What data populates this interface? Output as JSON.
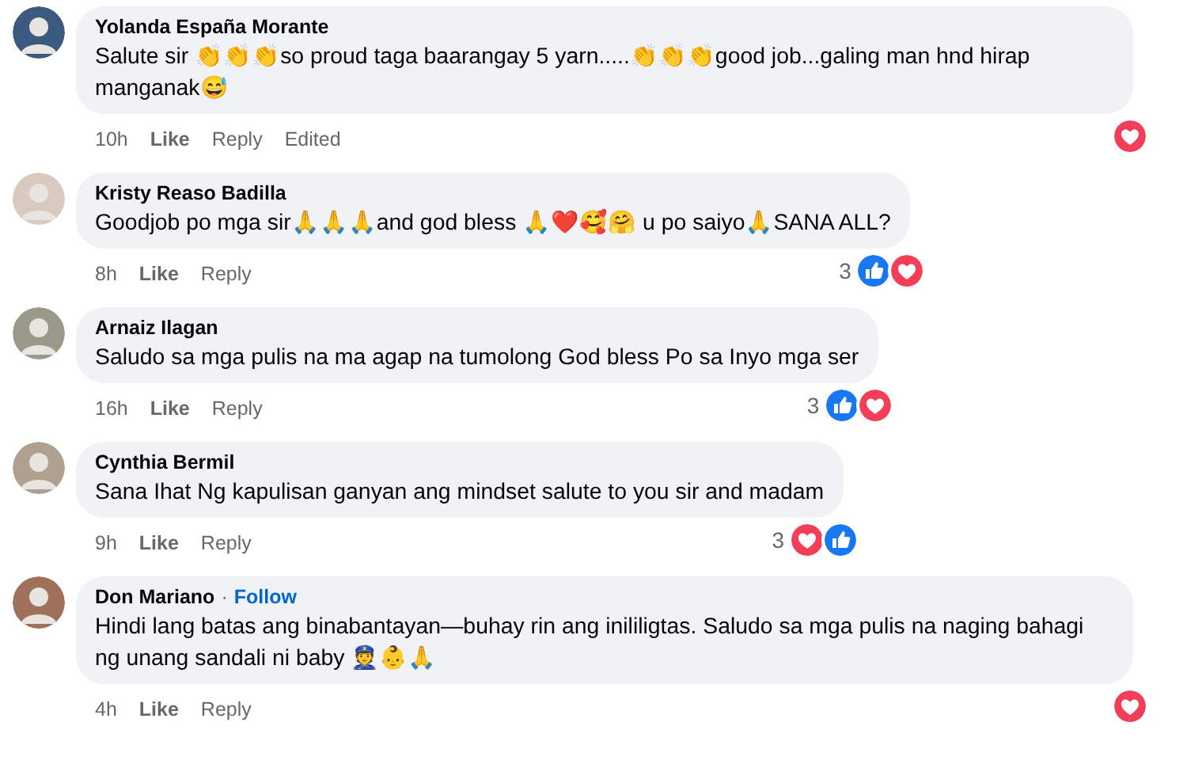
{
  "comments": [
    {
      "author": "Yolanda España Morante",
      "text": "Salute sir 👏👏👏so proud taga baarangay 5 yarn.....👏👏👏good job...galing man hnd hirap manganak😅",
      "time": "10h",
      "actions": [
        "Like",
        "Reply"
      ],
      "edited_label": "Edited",
      "reactions": [
        {
          "kind": "love"
        }
      ]
    },
    {
      "author": "Kristy Reaso Badilla",
      "text": "Goodjob po mga sir🙏🙏🙏and god bless 🙏❤️🥰🤗 u po saiyo🙏SANA ALL?",
      "time": "8h",
      "actions": [
        "Like",
        "Reply"
      ],
      "reaction_count": "3",
      "reactions": [
        {
          "kind": "like"
        },
        {
          "kind": "love"
        }
      ]
    },
    {
      "author": "Arnaiz Ilagan",
      "text": "Saludo sa mga pulis na ma agap na tumolong God bless Po sa Inyo mga ser",
      "time": "16h",
      "actions": [
        "Like",
        "Reply"
      ],
      "reaction_count": "3",
      "reactions": [
        {
          "kind": "like"
        },
        {
          "kind": "love"
        }
      ]
    },
    {
      "author": "Cynthia Bermil",
      "text": "Sana Ihat Ng kapulisan ganyan ang mindset salute to you sir and madam",
      "time": "9h",
      "actions": [
        "Like",
        "Reply"
      ],
      "reaction_count": "3",
      "reactions": [
        {
          "kind": "love"
        },
        {
          "kind": "like"
        }
      ]
    },
    {
      "author": "Don Mariano",
      "separator": "·",
      "follow_label": "Follow",
      "text": "Hindi lang batas ang binabantayan—buhay rin ang inililigtas. Saludo sa mga pulis na naging bahagi ng unang sandali ni baby 👮👶🙏",
      "time": "4h",
      "actions": [
        "Like",
        "Reply"
      ],
      "reactions": [
        {
          "kind": "love"
        }
      ]
    }
  ]
}
